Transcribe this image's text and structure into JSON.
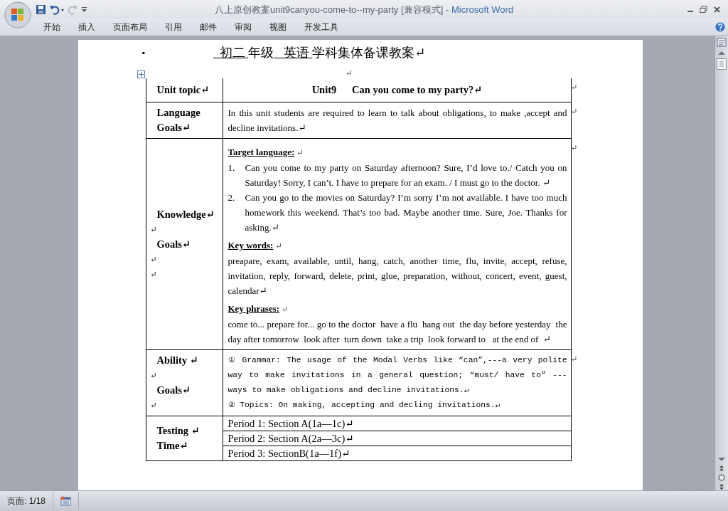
{
  "window": {
    "document_name": "八上原创教案unit9canyou-come-to--my-party [兼容模式]",
    "separator": "-",
    "app_name": "Microsoft Word"
  },
  "ribbon_tabs": [
    "开始",
    "插入",
    "页面布局",
    "引用",
    "邮件",
    "审阅",
    "视图",
    "开发工具"
  ],
  "document": {
    "heading_bullet": "▪",
    "heading": [
      {
        "text": "  初二 ",
        "underlined": true
      },
      {
        "text": "年级",
        "underlined": false
      },
      {
        "text": "   英语 ",
        "underlined": true
      },
      {
        "text": "学科集体备课教案↵",
        "underlined": false
      }
    ],
    "pre_table_mark": "↵",
    "table": {
      "rows": [
        {
          "label_lines": [
            "Unit topic↵"
          ],
          "row_mark": "↵",
          "content": {
            "kind": "title",
            "text": "Unit9      Can you come to my party?↵"
          }
        },
        {
          "label_lines": [
            "Language",
            "Goals↵"
          ],
          "row_mark": "↵",
          "content": {
            "kind": "paragraph",
            "text": "In this unit students are required to learn to talk about obligations, to make ,accept and decline invitations.↵"
          }
        },
        {
          "label_lines": [
            "Knowledge↵",
            "↵",
            "Goals↵",
            "↵",
            "↵"
          ],
          "row_mark": "↵",
          "content": {
            "kind": "sections",
            "sections": [
              {
                "heading": "Target language:",
                "mark": "↵",
                "items": [
                  {
                    "number": "1.",
                    "text": "Can you come to my party on Saturday afternoon? Sure, I’d love to./ Catch you on Saturday! Sorry, I can’t. I have to prepare for an exam. / I must go to the doctor. ↵"
                  },
                  {
                    "number": "2.",
                    "text": "Can you go to the movies on Saturday? I’m sorry I’m not available. I have too much homework this weekend. That’s too bad. Maybe another time. Sure, Joe. Thanks for asking.↵"
                  }
                ]
              },
              {
                "heading": "Key words:",
                "mark": "↵",
                "text": "preapare, exam, available, until, hang, catch, another time, flu, invite, accept, refuse, invitation, reply, forward, delete, print, glue, preparation, without, concert, event, guest, calendar↵"
              },
              {
                "heading": "Key phrases:",
                "mark": "↵",
                "text": "come to... prepare for... go to the doctor  have a flu  hang out  the day before yesterday  the day after tomorrow  look after  turn down  take a trip  look forward to   at the end of  ↵"
              }
            ]
          }
        },
        {
          "label_lines": [
            "Ability ↵",
            "↵",
            "Goals↵",
            "↵"
          ],
          "row_mark": "↵",
          "content": {
            "kind": "mono",
            "paragraphs": [
              "① Grammar: The usage of the Modal Verbs like “can”,---a very polite way to make invitations in a general question; “must/ have to” --- ways to make obligations and decline invitations.↵",
              "② Topics: On making, accepting and decling invitations.↵"
            ]
          }
        },
        {
          "label_lines": [
            "Testing ↵",
            "Time↵"
          ],
          "content": {
            "kind": "periods",
            "periods": [
              "Period 1: Section A(1a—1c)↵",
              "Period 2: Section A(2a—3c)↵",
              "Period 3: SectionB(1a—1f)↵"
            ]
          }
        }
      ]
    }
  },
  "status_bar": {
    "page": "页面: 1/18"
  }
}
